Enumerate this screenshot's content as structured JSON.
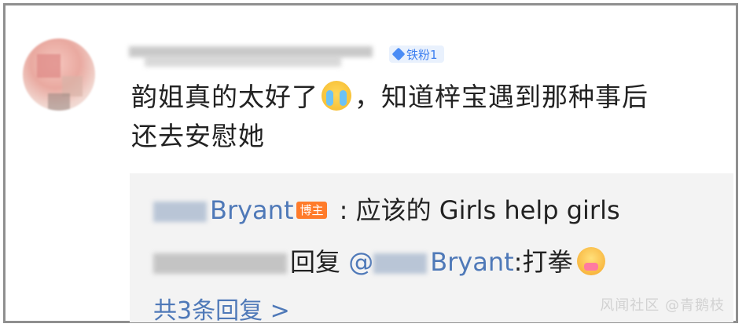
{
  "comment": {
    "user_badge": "铁粉1",
    "text_part1": "韵姐真的太好了",
    "text_part2": "，知道梓宝遇到那种事后",
    "text_line2": "还去安慰她"
  },
  "replies": [
    {
      "author_suffix": "Bryant",
      "author_tag": "博主",
      "text": " : 应该的 Girls help girls"
    },
    {
      "pre_text": "回复",
      "mention": "@",
      "mention_suffix": "Bryant",
      "text": ":打拳"
    }
  ],
  "more_replies": "共3条回复 >",
  "watermark": "风闻社区 @青鹅枝"
}
